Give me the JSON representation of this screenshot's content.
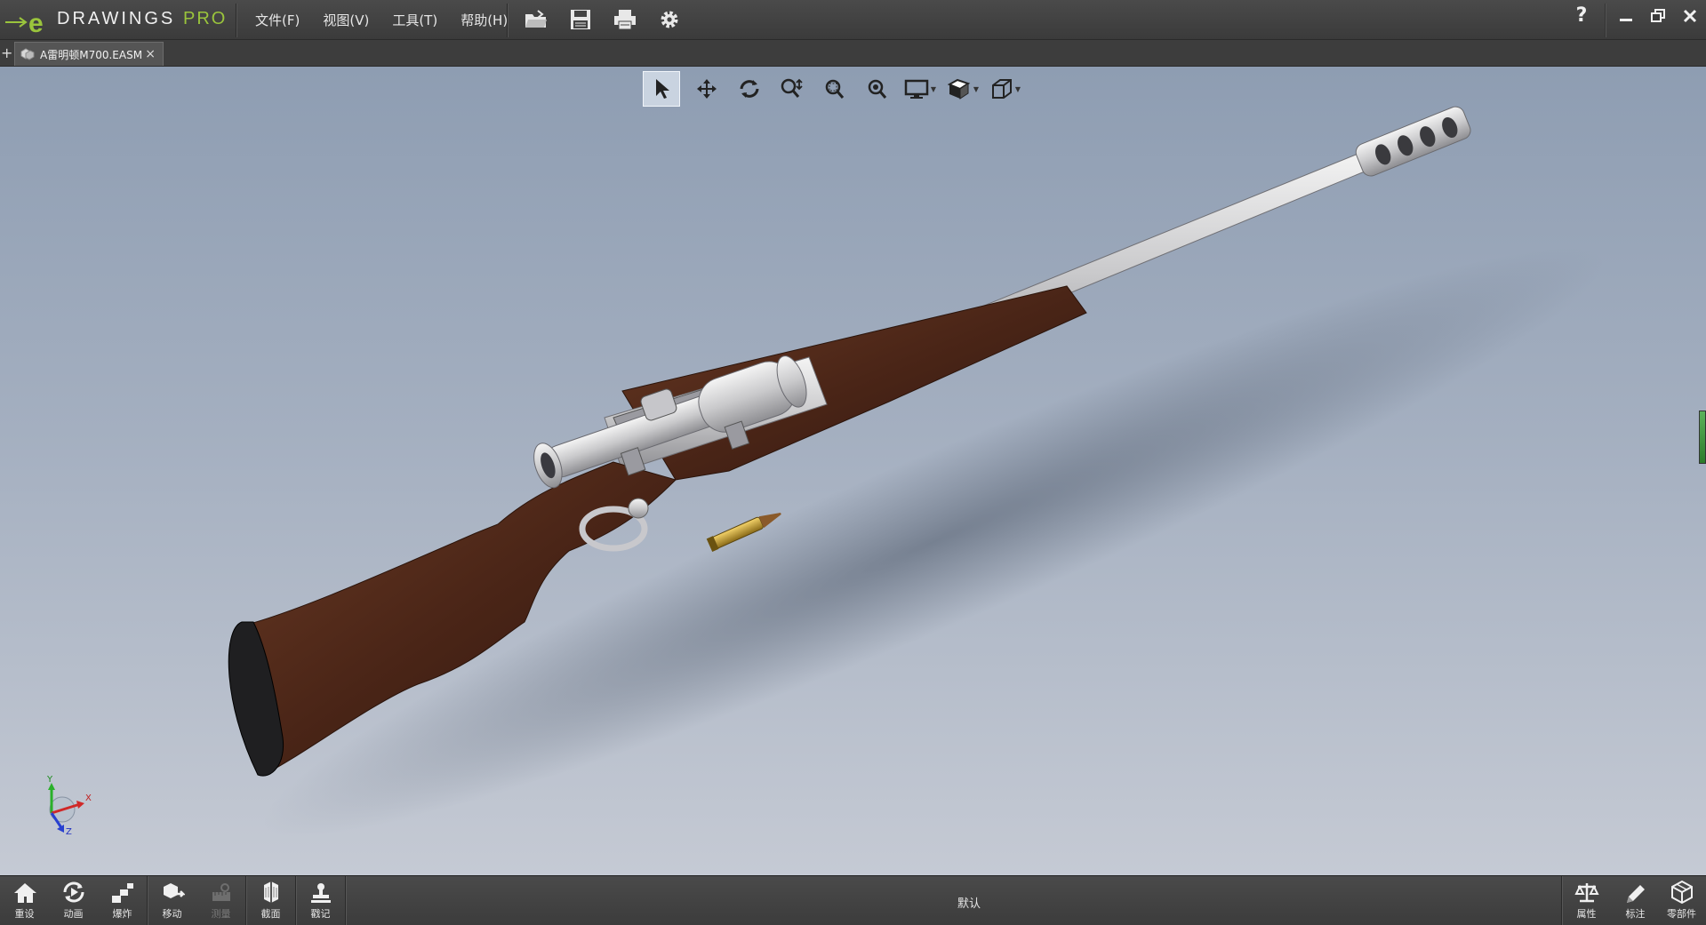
{
  "app": {
    "logo_word": "DRAWINGS",
    "logo_suffix": "PRO",
    "brand_color": "#9ac43c"
  },
  "menu": {
    "items": [
      {
        "label": "文件(F)"
      },
      {
        "label": "视图(V)"
      },
      {
        "label": "工具(T)"
      },
      {
        "label": "帮助(H)"
      }
    ]
  },
  "quick_tools": [
    "open-icon",
    "save-icon",
    "print-icon",
    "settings-icon"
  ],
  "window_controls": {
    "help": "?",
    "icons": [
      "minimize-icon",
      "restore-icon",
      "close-icon"
    ]
  },
  "tabs": {
    "new_tab": "+",
    "document": {
      "title": "A雷明顿M700.EASM",
      "close": "×"
    }
  },
  "view_toolbar": [
    "select-icon",
    "pan-icon",
    "rotate-icon",
    "zoom-icon",
    "zoom-area-icon",
    "zoom-fit-icon",
    "display-style-icon",
    "shading-icon",
    "standard-views-icon"
  ],
  "triad": {
    "x": "X",
    "y": "Y",
    "z": "Z"
  },
  "bottom_left": [
    {
      "label": "重设",
      "icon": "home-icon",
      "enabled": true
    },
    {
      "label": "动画",
      "icon": "animation-icon",
      "enabled": true
    },
    {
      "label": "爆炸",
      "icon": "explode-icon",
      "enabled": true
    },
    {
      "label": "移动",
      "icon": "move-icon",
      "enabled": true
    },
    {
      "label": "测量",
      "icon": "measure-icon",
      "enabled": false
    },
    {
      "label": "截面",
      "icon": "section-icon",
      "enabled": true
    },
    {
      "label": "戳记",
      "icon": "stamp-icon",
      "enabled": true
    }
  ],
  "configuration": "默认",
  "bottom_right": [
    {
      "label": "属性",
      "icon": "balance-icon"
    },
    {
      "label": "标注",
      "icon": "pencil-icon"
    },
    {
      "label": "零部件",
      "icon": "components-icon"
    }
  ]
}
